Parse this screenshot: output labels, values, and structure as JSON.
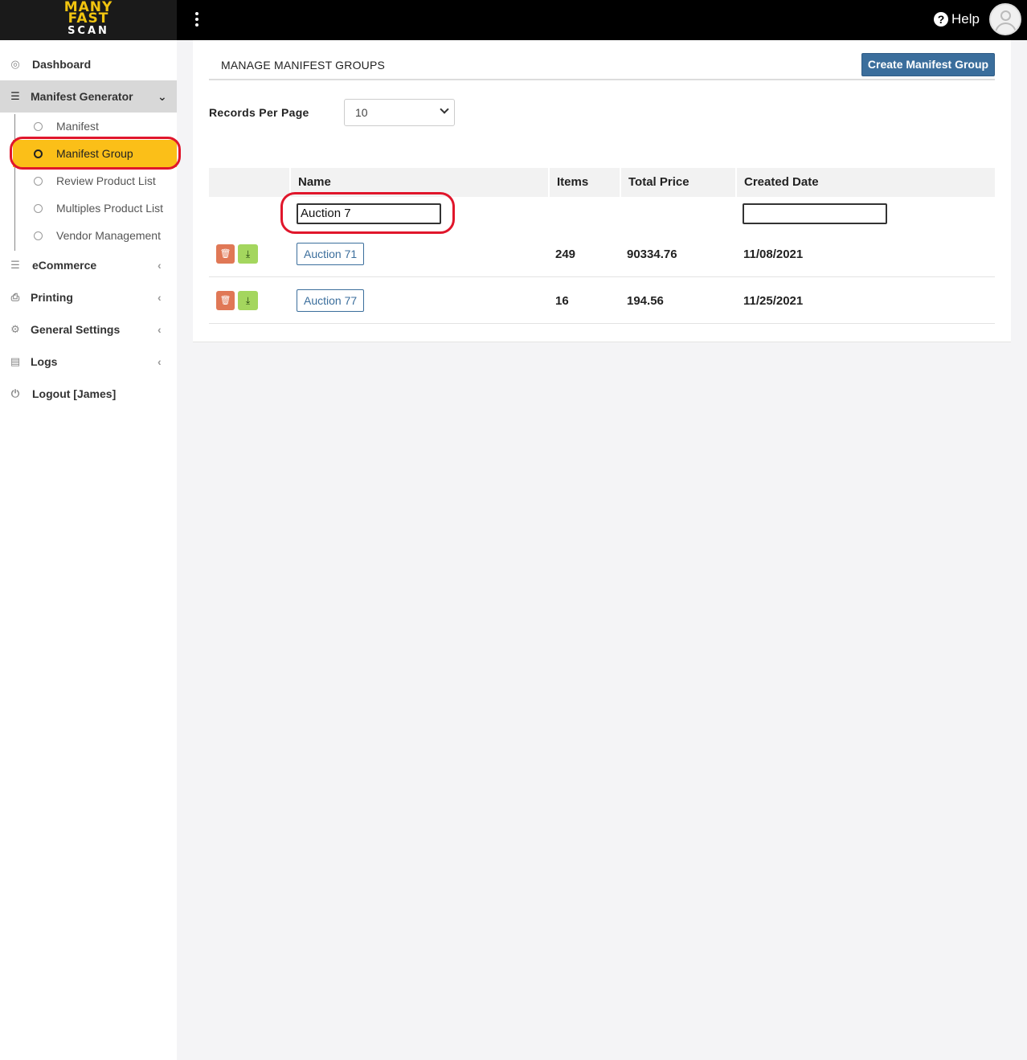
{
  "app": {
    "logo": {
      "line1": "MANY",
      "line2": "FAST",
      "line3": "SCAN"
    },
    "help_label": "Help"
  },
  "sidebar": {
    "items": [
      {
        "label": "Dashboard",
        "icon": "compass-icon"
      },
      {
        "label": "Manifest Generator",
        "icon": "list-icon",
        "expanded": true
      },
      {
        "label": "eCommerce",
        "icon": "list-icon"
      },
      {
        "label": "Printing",
        "icon": "printer-icon"
      },
      {
        "label": "General Settings",
        "icon": "gears-icon"
      },
      {
        "label": "Logs",
        "icon": "archive-icon"
      },
      {
        "label": "Logout [James]",
        "icon": "power-icon"
      }
    ],
    "subitems": [
      {
        "label": "Manifest"
      },
      {
        "label": "Manifest Group",
        "active": true
      },
      {
        "label": "Review Product List"
      },
      {
        "label": "Multiples Product List"
      },
      {
        "label": "Vendor Management"
      }
    ]
  },
  "main": {
    "title": "MANAGE MANIFEST GROUPS",
    "create_button": "Create Manifest Group",
    "records_per_page_label": "Records Per Page",
    "records_per_page_value": "10",
    "table": {
      "columns": [
        "Name",
        "Items",
        "Total Price",
        "Created Date"
      ],
      "filters": {
        "name": "Auction 7",
        "created_date": ""
      },
      "rows": [
        {
          "name": "Auction 71",
          "items": "249",
          "total_price": "90334.76",
          "created_date": "11/08/2021"
        },
        {
          "name": "Auction 77",
          "items": "16",
          "total_price": "194.56",
          "created_date": "11/25/2021"
        }
      ]
    }
  },
  "colors": {
    "active_subitem": "#fbbf18",
    "primary_button": "#3b6e9c",
    "delete_button": "#e07856",
    "download_button": "#a4d65e",
    "highlight_ring": "#e0162b"
  }
}
